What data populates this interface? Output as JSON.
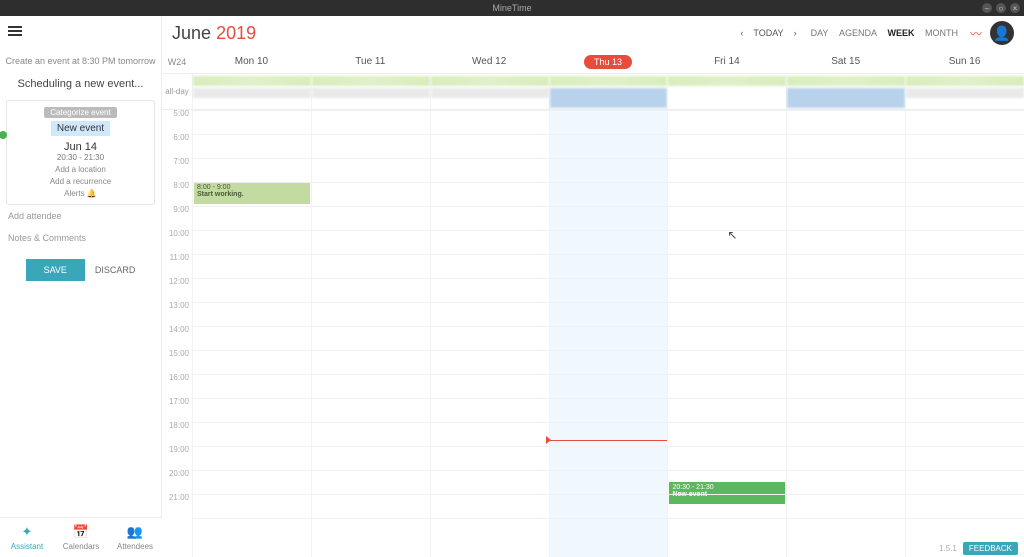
{
  "window": {
    "title": "MineTime"
  },
  "header": {
    "month": "June",
    "year": "2019",
    "today_label": "TODAY",
    "views": [
      "DAY",
      "AGENDA",
      "WEEK",
      "MONTH"
    ],
    "active_view": "WEEK"
  },
  "sidebar": {
    "create_hint": "Create an event at 8:30 PM tomorrow",
    "scheduling_title": "Scheduling a new event...",
    "categorize_label": "Categorize event",
    "event_title": "New event",
    "event_date": "Jun 14",
    "event_time": "20:30 - 21:30",
    "add_location": "Add a location",
    "add_recurrence": "Add a recurrence",
    "alerts_label": "Alerts",
    "add_attendee": "Add attendee",
    "notes": "Notes & Comments",
    "save_label": "SAVE",
    "discard_label": "DISCARD",
    "tabs": [
      "Assistant",
      "Calendars",
      "Attendees"
    ]
  },
  "calendar": {
    "week_label": "W24",
    "allday": "all-day",
    "days": [
      "Mon 10",
      "Tue 11",
      "Wed 12",
      "Thu 13",
      "Fri 14",
      "Sat 15",
      "Sun 16"
    ],
    "today_index": 3,
    "hours": [
      "5:00",
      "6:00",
      "7:00",
      "8:00",
      "9:00",
      "10:00",
      "11:00",
      "12:00",
      "13:00",
      "14:00",
      "15:00",
      "16:00",
      "17:00",
      "18:00",
      "19:00",
      "20:00",
      "21:00"
    ],
    "events": {
      "mon_work": {
        "time": "8:00 - 9:00",
        "title": "Start working."
      },
      "fri_new": {
        "time": "20:30 - 21:30",
        "title": "New event"
      }
    }
  },
  "footer": {
    "version": "1.5.1",
    "feedback": "FEEDBACK"
  }
}
